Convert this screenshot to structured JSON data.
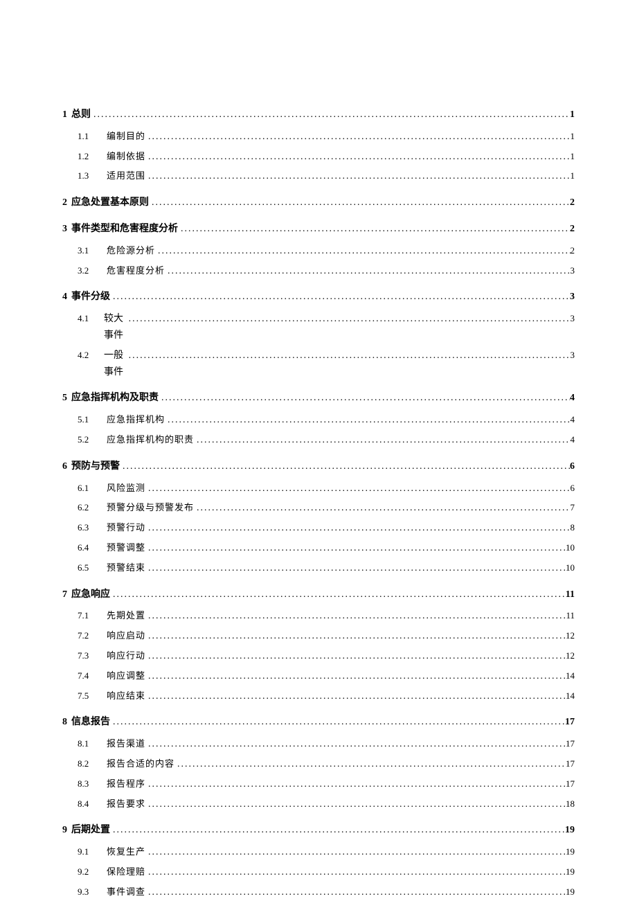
{
  "toc": [
    {
      "level": 1,
      "num": "1",
      "title": "总则",
      "page": "1"
    },
    {
      "level": 2,
      "num": "1.1",
      "title": "编制目的",
      "page": "1"
    },
    {
      "level": 2,
      "num": "1.2",
      "title": "编制依据",
      "page": "1"
    },
    {
      "level": 2,
      "num": "1.3",
      "title": "适用范围",
      "page": "1"
    },
    {
      "level": 1,
      "num": "2",
      "title": "应急处置基本原则",
      "page": "2"
    },
    {
      "level": 1,
      "num": "3",
      "title": "事件类型和危害程度分析",
      "page": "2"
    },
    {
      "level": 2,
      "num": "3.1",
      "title": "危险源分析",
      "page": "2"
    },
    {
      "level": 2,
      "num": "3.2",
      "title": "危害程度分析",
      "page": "3"
    },
    {
      "level": 1,
      "num": "4",
      "title": "事件分级",
      "page": "3"
    },
    {
      "level": 2,
      "num": "4.1",
      "title": "较大事件",
      "page": "3",
      "inline": true
    },
    {
      "level": 2,
      "num": "4.2",
      "title": "一般事件",
      "page": "3",
      "inline": true
    },
    {
      "level": 1,
      "num": "5",
      "title": "应急指挥机构及职责",
      "page": "4"
    },
    {
      "level": 2,
      "num": "5.1",
      "title": "应急指挥机构",
      "page": "4"
    },
    {
      "level": 2,
      "num": "5.2",
      "title": "应急指挥机构的职责",
      "page": "4"
    },
    {
      "level": 1,
      "num": "6",
      "title": "预防与预警",
      "page": "6"
    },
    {
      "level": 2,
      "num": "6.1",
      "title": "风险监测",
      "page": "6"
    },
    {
      "level": 2,
      "num": "6.2",
      "title": "预警分级与预警发布",
      "page": "7"
    },
    {
      "level": 2,
      "num": "6.3",
      "title": "预警行动",
      "page": "8"
    },
    {
      "level": 2,
      "num": "6.4",
      "title": "预警调整",
      "page": "10"
    },
    {
      "level": 2,
      "num": "6.5",
      "title": "预警结束",
      "page": "10"
    },
    {
      "level": 1,
      "num": "7",
      "title": "应急响应",
      "page": "11"
    },
    {
      "level": 2,
      "num": "7.1",
      "title": "先期处置",
      "page": "11"
    },
    {
      "level": 2,
      "num": "7.2",
      "title": "响应启动",
      "page": "12"
    },
    {
      "level": 2,
      "num": "7.3",
      "title": "响应行动",
      "page": "12"
    },
    {
      "level": 2,
      "num": "7.4",
      "title": "响应调整",
      "page": "14"
    },
    {
      "level": 2,
      "num": "7.5",
      "title": "响应结束",
      "page": "14"
    },
    {
      "level": 1,
      "num": "8",
      "title": "信息报告",
      "page": "17"
    },
    {
      "level": 2,
      "num": "8.1",
      "title": "报告渠道",
      "page": "17"
    },
    {
      "level": 2,
      "num": "8.2",
      "title": "报告合适的内容",
      "page": "17"
    },
    {
      "level": 2,
      "num": "8.3",
      "title": "报告程序",
      "page": "17"
    },
    {
      "level": 2,
      "num": "8.4",
      "title": "报告要求",
      "page": "18"
    },
    {
      "level": 1,
      "num": "9",
      "title": "后期处置",
      "page": "19"
    },
    {
      "level": 2,
      "num": "9.1",
      "title": "恢复生产",
      "page": "19"
    },
    {
      "level": 2,
      "num": "9.2",
      "title": "保险理赔",
      "page": "19"
    },
    {
      "level": 2,
      "num": "9.3",
      "title": "事件调查",
      "page": "19"
    }
  ]
}
